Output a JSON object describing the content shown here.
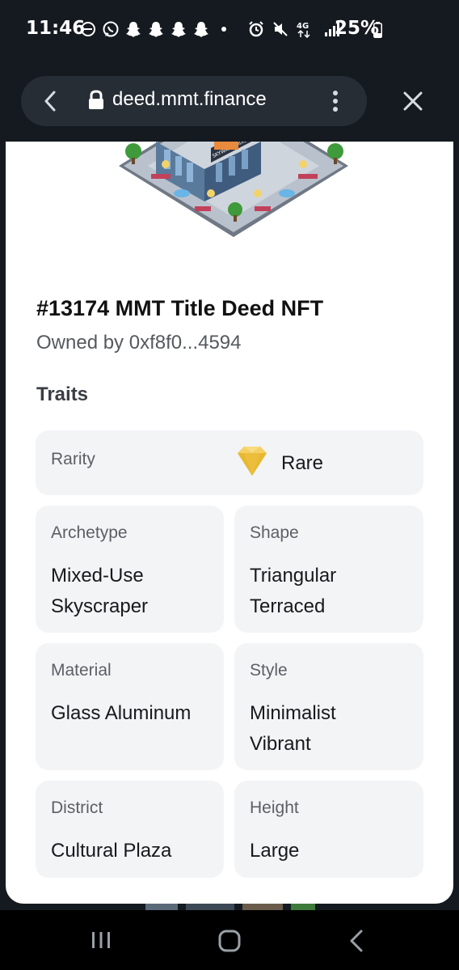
{
  "status_bar": {
    "time": "11:46",
    "battery": "25%",
    "network": "4G",
    "left_icons": [
      "do-not-disturb-icon",
      "whatsapp-icon",
      "snapchat-icon",
      "snapchat-icon",
      "snapchat-icon",
      "snapchat-icon",
      "dot-icon"
    ],
    "right_icons": [
      "alarm-icon",
      "mute-icon",
      "4g-icon",
      "signal-icon",
      "battery-icon"
    ]
  },
  "browser": {
    "url": "deed.mmt.finance",
    "icons": [
      "back-arrow-icon",
      "lock-icon",
      "more-vert-icon",
      "close-icon"
    ]
  },
  "nft": {
    "title": "#13174 MMT Title Deed NFT",
    "owner": "Owned by 0xf8f0...4594",
    "building_sign": "SKYWARD MIXED TOWER"
  },
  "traits": {
    "heading": "Traits",
    "rarity": {
      "label": "Rarity",
      "value": "Rare",
      "icon": "diamond-icon"
    },
    "items": [
      {
        "label": "Archetype",
        "value": "Mixed-Use\nSkyscraper"
      },
      {
        "label": "Shape",
        "value": "Triangular\nTerraced"
      },
      {
        "label": "Material",
        "value": "Glass Aluminum"
      },
      {
        "label": "Style",
        "value": "Minimalist\nVibrant"
      },
      {
        "label": "District",
        "value": "Cultural Plaza"
      },
      {
        "label": "Height",
        "value": "Large"
      }
    ]
  },
  "nav_bar": {
    "icons": [
      "recents-icon",
      "home-icon",
      "back-icon"
    ]
  },
  "colors": {
    "status_bg": "#141a20",
    "url_bar_bg": "#272d35",
    "card_bg": "#f3f4f6",
    "gem": "#f2c744"
  }
}
